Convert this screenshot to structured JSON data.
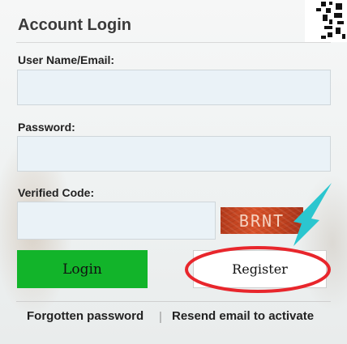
{
  "form": {
    "title": "Account Login",
    "username_label": "User Name/Email:",
    "username_value": "",
    "password_label": "Password:",
    "password_value": "",
    "code_label": "Verified Code:",
    "code_value": "",
    "captcha_text": "BRNT",
    "login_label": "Login",
    "register_label": "Register"
  },
  "links": {
    "forgot": "Forgotten password",
    "separator": "|",
    "resend": "Resend email to activate"
  },
  "annotation": {
    "circle_color": "#e8262c",
    "arrow_color": "#2bc6cf"
  }
}
